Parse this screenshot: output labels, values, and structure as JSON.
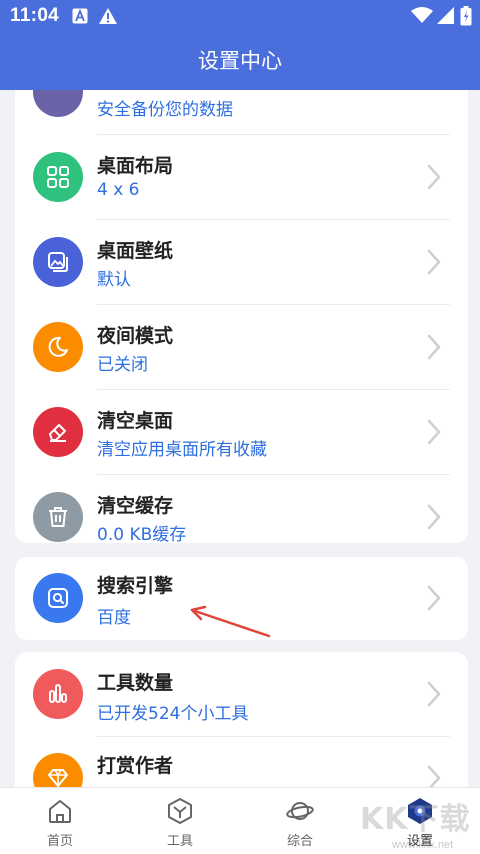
{
  "status_bar": {
    "time": "11:04"
  },
  "app_bar": {
    "title": "设置中心"
  },
  "cards": [
    {
      "rows": [
        {
          "title": "",
          "subtitle": "安全备份您的数据",
          "icon": "backup-icon",
          "color": "#6b63a8"
        },
        {
          "title": "桌面布局",
          "subtitle": "4 x 6",
          "icon": "grid-icon",
          "color": "#2ec27e"
        },
        {
          "title": "桌面壁纸",
          "subtitle": "默认",
          "icon": "wallpaper-icon",
          "color": "#4a62d8"
        },
        {
          "title": "夜间模式",
          "subtitle": "已关闭",
          "icon": "moon-icon",
          "color": "#fb8c00"
        },
        {
          "title": "清空桌面",
          "subtitle": "清空应用桌面所有收藏",
          "icon": "eraser-icon",
          "color": "#e0303f"
        },
        {
          "title": "清空缓存",
          "subtitle": "0.0 KB缓存",
          "icon": "trash-icon",
          "color": "#8e9aa4"
        }
      ]
    },
    {
      "rows": [
        {
          "title": "搜索引擎",
          "subtitle": "百度",
          "icon": "search-icon",
          "color": "#3978ef"
        }
      ]
    },
    {
      "rows": [
        {
          "title": "工具数量",
          "subtitle": "已开发524个小工具",
          "icon": "bar-chart-icon",
          "color": "#f05a5a"
        },
        {
          "title": "打赏作者",
          "subtitle": "",
          "icon": "diamond-icon",
          "color": "#fb8c00"
        }
      ]
    }
  ],
  "tab_bar": {
    "tabs": [
      {
        "label": "首页",
        "icon": "home-icon"
      },
      {
        "label": "工具",
        "icon": "cube-icon"
      },
      {
        "label": "综合",
        "icon": "planet-icon"
      },
      {
        "label": "设置",
        "icon": "settings-icon",
        "active": true
      }
    ]
  },
  "watermark": {
    "text": "KK下载",
    "sub": "www.kkx.net"
  },
  "colors": {
    "primary": "#4a6fdc",
    "link": "#2f6fe0",
    "annotation": "#e0443a"
  }
}
